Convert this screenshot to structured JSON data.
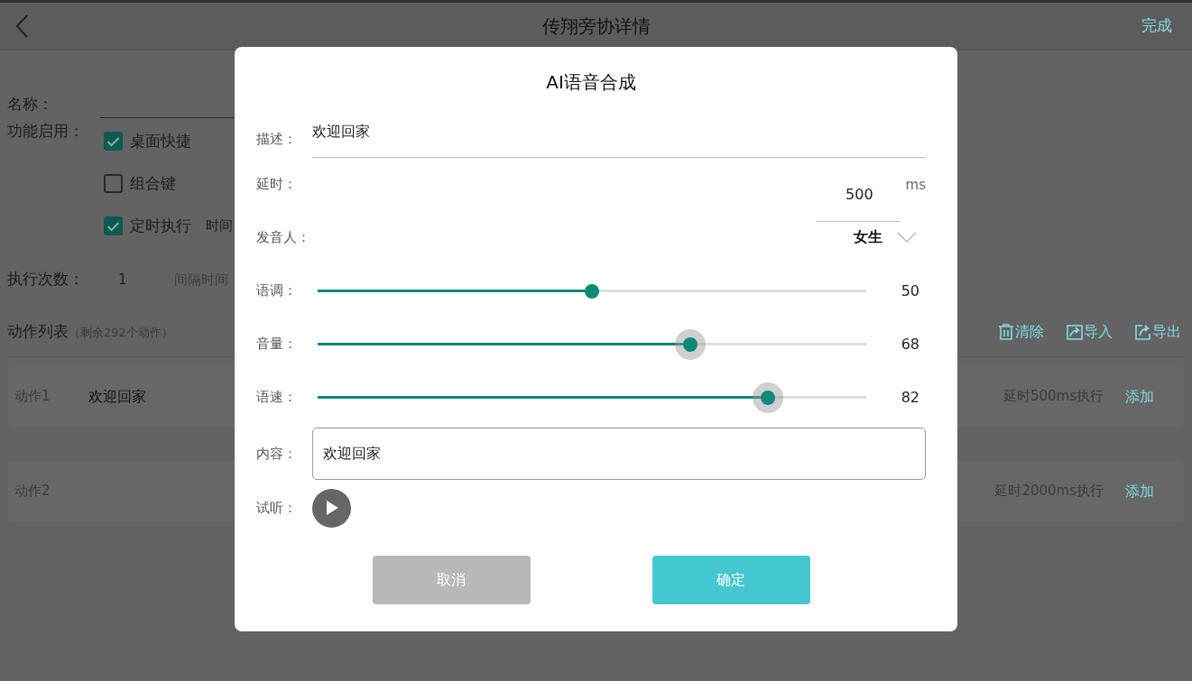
{
  "header": {
    "title": "传翔旁协详情",
    "action": "完成"
  },
  "form": {
    "name_label": "名称：",
    "function_label": "功能启用：",
    "options": [
      {
        "label": "桌面快捷",
        "checked": true
      },
      {
        "label": "组合键",
        "checked": false
      },
      {
        "label": "定时执行",
        "checked": true,
        "hint": "时间"
      }
    ],
    "count_label": "执行次数：",
    "count_value": "1",
    "interval_label": "间隔时间"
  },
  "actions": {
    "title": "动作列表",
    "remaining": "（剩余292个动作）",
    "tools": [
      {
        "kind": "trash",
        "label": "清除"
      },
      {
        "kind": "import",
        "label": "导入"
      },
      {
        "kind": "export",
        "label": "导出"
      }
    ],
    "items": [
      {
        "label": "动作1",
        "name": "欢迎回家",
        "delay": "延时500ms执行",
        "add": "添加"
      },
      {
        "label": "动作2",
        "delay": "延时2000ms执行",
        "add": "添加"
      }
    ]
  },
  "dialog": {
    "title": "AI语音合成",
    "description": {
      "label": "描述：",
      "value": "欢迎回家"
    },
    "delay": {
      "label": "延时：",
      "value": "500",
      "unit": "ms"
    },
    "speaker": {
      "label": "发音人：",
      "value": "女生"
    },
    "sliders": [
      {
        "label": "语调：",
        "level": 0.5,
        "reading": "50",
        "highlighted": false
      },
      {
        "label": "音量：",
        "level": 0.68,
        "reading": "68",
        "highlighted": true
      },
      {
        "label": "语速：",
        "level": 0.82,
        "reading": "82",
        "highlighted": true
      }
    ],
    "content": {
      "label": "内容：",
      "value": "欢迎回家"
    },
    "preview": {
      "label": "试听："
    },
    "buttons": [
      {
        "kind": "cancel",
        "label": "取消"
      },
      {
        "kind": "confirm",
        "label": "确定"
      }
    ]
  }
}
